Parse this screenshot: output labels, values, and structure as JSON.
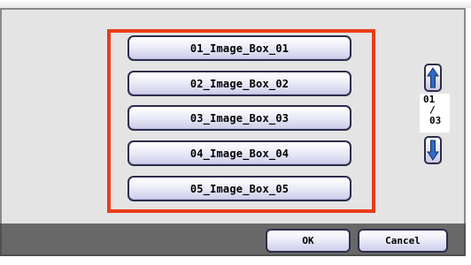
{
  "image_boxes": [
    {
      "label": "01_Image_Box_01"
    },
    {
      "label": "02_Image_Box_02"
    },
    {
      "label": "03_Image_Box_03"
    },
    {
      "label": "04_Image_Box_04"
    },
    {
      "label": "05_Image_Box_05"
    }
  ],
  "pagination": {
    "current": "01",
    "separator": "/",
    "total": "03"
  },
  "scroll": {
    "up_icon": "arrow-up-icon",
    "down_icon": "arrow-down-icon"
  },
  "footer": {
    "ok_label": "OK",
    "cancel_label": "Cancel"
  },
  "colors": {
    "highlight": "#e83d18",
    "panel_background": "#e4e4e4",
    "footer_background": "#686868",
    "button_border": "#2d2d4d",
    "arrow_fill": "#2f69c8"
  }
}
